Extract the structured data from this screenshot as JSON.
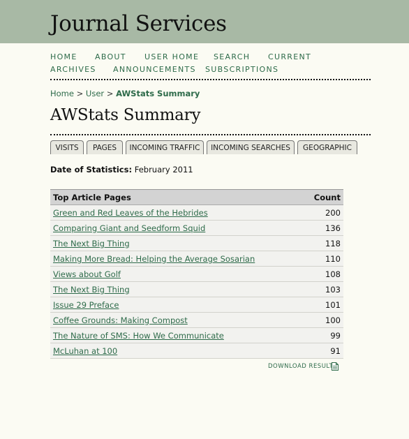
{
  "site": {
    "title": "Journal Services"
  },
  "nav": {
    "home": "HOME",
    "about": "ABOUT",
    "user_home": "USER HOME",
    "search": "SEARCH",
    "current": "CURRENT",
    "archives": "ARCHIVES",
    "announcements": "ANNOUNCEMENTS",
    "subscriptions": "SUBSCRIPTIONS"
  },
  "breadcrumb": {
    "home": "Home",
    "sep1": ">",
    "user": "User",
    "sep2": ">",
    "current": "AWStats Summary"
  },
  "page": {
    "title": "AWStats Summary"
  },
  "tabs": [
    "VISITS",
    "PAGES",
    "INCOMING TRAFFIC",
    "INCOMING SEARCHES",
    "GEOGRAPHIC"
  ],
  "stats": {
    "date_label": "Date of Statistics:",
    "date_value": "February 2011"
  },
  "table": {
    "header_title": "Top Article Pages",
    "header_count": "Count",
    "rows": [
      {
        "title": "Green and Red Leaves of the Hebrides",
        "count": "200"
      },
      {
        "title": "Comparing Giant and Seedform Squid",
        "count": "136"
      },
      {
        "title": "The Next Big Thing",
        "count": "118"
      },
      {
        "title": "Making More Bread: Helping the Average Sosarian",
        "count": "110"
      },
      {
        "title": "Views about Golf",
        "count": "108"
      },
      {
        "title": "The Next Big Thing",
        "count": "103"
      },
      {
        "title": "Issue 29 Preface",
        "count": "101"
      },
      {
        "title": "Coffee Grounds: Making Compost",
        "count": "100"
      },
      {
        "title": "The Nature of SMS: How We Communicate",
        "count": "99"
      },
      {
        "title": "McLuhan at 100",
        "count": "91"
      }
    ]
  },
  "download": {
    "label": "DOWNLOAD RESULTS",
    "icon": "document-icon"
  },
  "colors": {
    "header_bg": "#a8b9a5",
    "link": "#2e6b4a",
    "page_bg": "#fbfbf3"
  }
}
